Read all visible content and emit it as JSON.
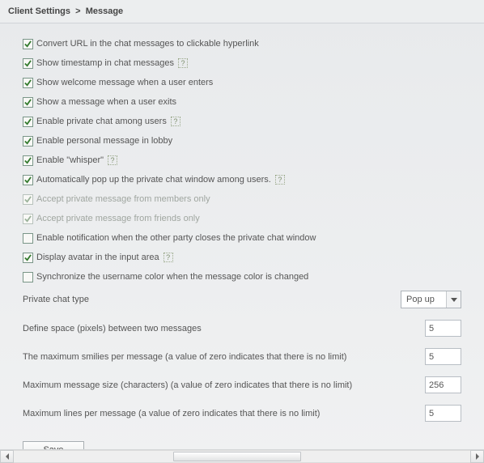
{
  "breadcrumb": {
    "parent": "Client Settings",
    "separator": ">",
    "current": "Message"
  },
  "options": [
    {
      "label": "Convert URL in the chat messages to clickable hyperlink",
      "checked": true,
      "disabled": false,
      "help": false
    },
    {
      "label": "Show timestamp in chat messages",
      "checked": true,
      "disabled": false,
      "help": true
    },
    {
      "label": "Show welcome message when a user enters",
      "checked": true,
      "disabled": false,
      "help": false
    },
    {
      "label": "Show a message when a user exits",
      "checked": true,
      "disabled": false,
      "help": false
    },
    {
      "label": "Enable private chat among users",
      "checked": true,
      "disabled": false,
      "help": true
    },
    {
      "label": "Enable personal message in lobby",
      "checked": true,
      "disabled": false,
      "help": false
    },
    {
      "label": "Enable \"whisper\"",
      "checked": true,
      "disabled": false,
      "help": true
    },
    {
      "label": "Automatically pop up the private chat window among users.",
      "checked": true,
      "disabled": false,
      "help": true
    },
    {
      "label": "Accept private message from members only",
      "checked": true,
      "disabled": true,
      "help": false
    },
    {
      "label": "Accept private message from friends only",
      "checked": true,
      "disabled": true,
      "help": false
    },
    {
      "label": "Enable notification when the other party closes the private chat window",
      "checked": false,
      "disabled": false,
      "help": false
    },
    {
      "label": "Display avatar in the input area",
      "checked": true,
      "disabled": false,
      "help": true
    },
    {
      "label": "Synchronize the username color when the message color is changed",
      "checked": false,
      "disabled": false,
      "help": false
    }
  ],
  "privateChat": {
    "label": "Private chat type",
    "value": "Pop up"
  },
  "numeric": [
    {
      "label": "Define space (pixels) between two messages",
      "value": "5"
    },
    {
      "label": "The maximum smilies per message  (a value of zero indicates that there is no limit)",
      "value": "5"
    },
    {
      "label": "Maximum message size (characters)  (a value of zero indicates that there is no limit)",
      "value": "256"
    },
    {
      "label": "Maximum lines per message (a value of zero indicates that there is no limit)",
      "value": "5"
    }
  ],
  "saveLabel": "Save",
  "helpGlyph": "?"
}
